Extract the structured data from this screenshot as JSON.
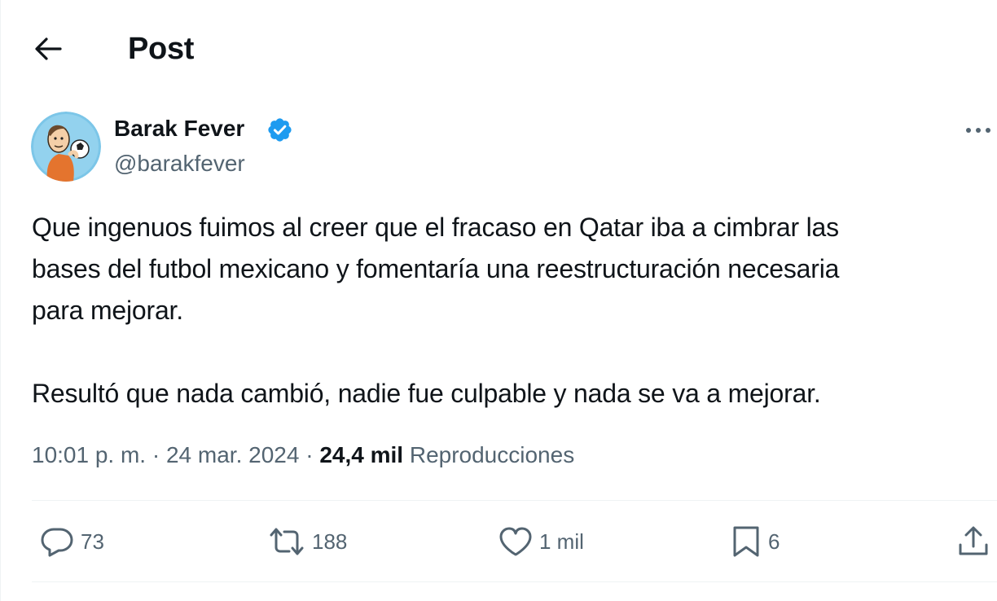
{
  "header": {
    "title": "Post",
    "back_icon": "arrow-left-icon"
  },
  "author": {
    "display_name": "Barak Fever",
    "handle": "@barakfever",
    "verified": true,
    "verified_color": "#1d9bf0",
    "avatar_icon": "cartoon-avatar-holding-soccer-ball"
  },
  "tweet": {
    "paragraphs": [
      "Que ingenuos fuimos al creer que el fracaso en Qatar iba a cimbrar las\nbases del futbol mexicano y fomentaría una reestructuración necesaria\npara mejorar.",
      "Resultó que nada cambió, nadie fue culpable y nada se va a mejorar."
    ]
  },
  "meta": {
    "time": "10:01 p. m.",
    "separator": "·",
    "date": "24 mar. 2024",
    "views_count": "24,4 mil",
    "views_label": "Reproducciones"
  },
  "actions": {
    "reply": {
      "icon": "reply-bubble-icon",
      "count": "73"
    },
    "retweet": {
      "icon": "retweet-icon",
      "count": "188"
    },
    "like": {
      "icon": "heart-icon",
      "count": "1 mil"
    },
    "bookmark": {
      "icon": "bookmark-icon",
      "count": "6"
    },
    "share": {
      "icon": "share-upload-icon"
    }
  },
  "colors": {
    "text_primary": "#0f1419",
    "text_secondary": "#536471",
    "divider": "#eff3f4",
    "accent": "#1d9bf0"
  }
}
